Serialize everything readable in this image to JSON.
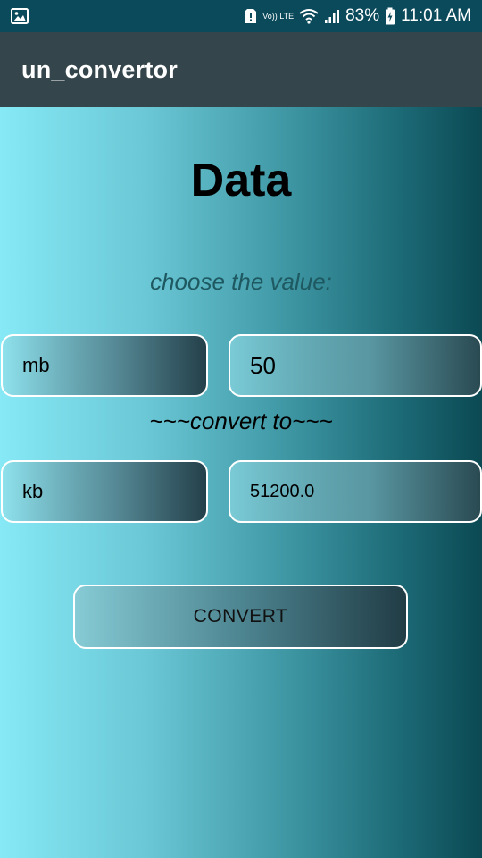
{
  "status_bar": {
    "volte_label": "Vo)) LTE",
    "battery_percent": "83%",
    "time": "11:01 AM",
    "icons": [
      "image-icon",
      "sim-alert-icon",
      "volte-icon",
      "wifi-icon",
      "signal-icon",
      "battery-charging-icon"
    ]
  },
  "app_bar": {
    "title": "un_convertor"
  },
  "main": {
    "heading": "Data",
    "instruction": "choose the value:",
    "from_unit": "mb",
    "from_value": "50",
    "convert_to_label": "~~~convert to~~~",
    "to_unit": "kb",
    "to_value": "51200.0",
    "convert_button_label": "CONVERT"
  },
  "colors": {
    "status_bar_bg": "#0b4a5b",
    "app_bar_bg": "#34464b",
    "gradient_light": "#86e9f5",
    "gradient_dark": "#0b4953",
    "instruction_text": "#1e5961"
  }
}
